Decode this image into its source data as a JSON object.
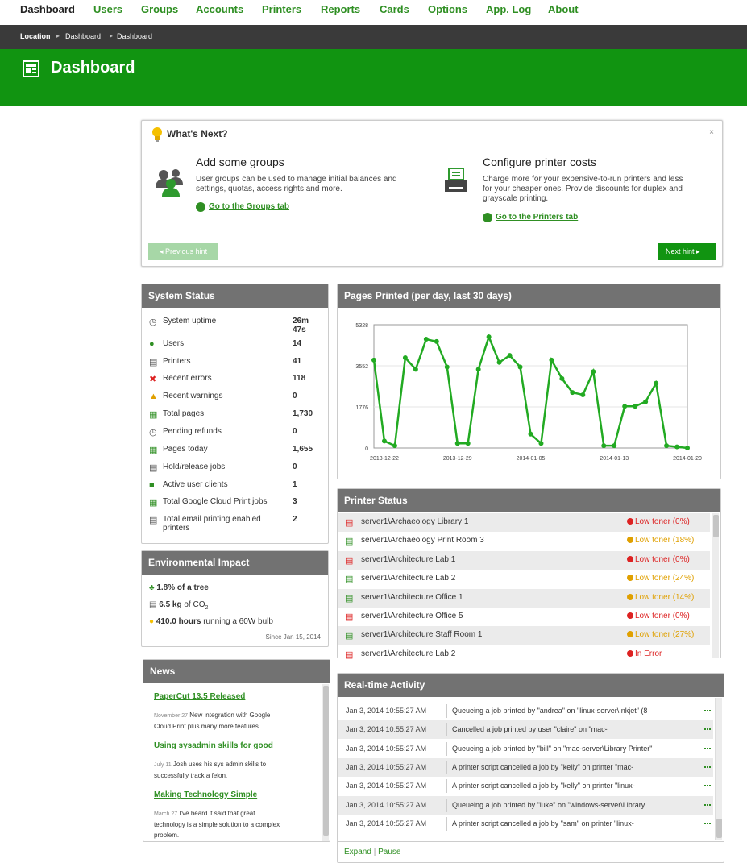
{
  "nav": {
    "items": [
      "Dashboard",
      "Users",
      "Groups",
      "Accounts",
      "Printers",
      "Reports",
      "Cards",
      "Options",
      "App. Log",
      "About"
    ]
  },
  "breadcrumb": {
    "location": "Location",
    "items": [
      "Dashboard",
      "Dashboard"
    ]
  },
  "header": {
    "title": "Dashboard"
  },
  "whats_next": {
    "title": "What's Next?",
    "close": "×",
    "left": {
      "heading": "Add some groups",
      "text1": "User groups can be used to manage initial balances and",
      "text2": "settings, quotas, access rights and more.",
      "link": "Go to the Groups tab"
    },
    "right": {
      "heading": "Configure printer costs",
      "text1": "Charge more for your expensive-to-run printers and less",
      "text2": "for your cheaper ones. Provide discounts for duplex and",
      "text3": "grayscale printing.",
      "link": "Go to the Printers tab"
    },
    "prev_label": "Previous hint",
    "next_label": "Next hint"
  },
  "system_status": {
    "title": "System Status",
    "rows": [
      {
        "label": "System uptime",
        "value": "26m",
        "value2": "47s",
        "icon": "clock-icon"
      },
      {
        "label": "Users",
        "value": "14",
        "icon": "users-icon"
      },
      {
        "label": "Printers",
        "value": "41",
        "icon": "printer-icon"
      },
      {
        "label": "Recent errors",
        "value": "118",
        "icon": "error-x-icon"
      },
      {
        "label": "Recent warnings",
        "value": "0",
        "icon": "warning-icon"
      },
      {
        "label": "Total pages",
        "value": "1,730",
        "icon": "pages-icon"
      },
      {
        "label": "Pending refunds",
        "value": "0",
        "icon": "clock-icon"
      },
      {
        "label": "Pages today",
        "value": "1,655",
        "icon": "pages-icon"
      },
      {
        "label": "Hold/release jobs",
        "value": "0",
        "icon": "printer-icon"
      },
      {
        "label": "Active user clients",
        "value": "1",
        "icon": "client-icon"
      },
      {
        "label": "Total Google Cloud Print jobs",
        "value": "3",
        "icon": "pages-icon"
      },
      {
        "label": "Total email printing enabled",
        "label2": "printers",
        "value": "2",
        "icon": "printer-icon"
      }
    ]
  },
  "environment": {
    "title": "Environmental Impact",
    "tree_value": "1.8% of a tree",
    "co2_value": "6.5 kg",
    "co2_rest": "of CO",
    "co2_sub": "2",
    "bulb_value": "410.0 hours",
    "bulb_rest": "running a 60W bulb",
    "since": "Since Jan 15, 2014"
  },
  "news": {
    "title": "News",
    "items": [
      {
        "title": "PaperCut 13.5 Released",
        "date": "November 27",
        "text1": "New integration with Google",
        "text2": "Cloud Print plus many more features."
      },
      {
        "title": "Using sysadmin skills for good",
        "date": "July 11",
        "text1": "Josh uses his sys admin skills to",
        "text2": "successfully track a felon."
      },
      {
        "title": "Making Technology Simple",
        "date": "March 27",
        "text1": "I've heard it said that great",
        "text2": "technology is a simple solution to a complex",
        "text3": "problem."
      }
    ]
  },
  "chart_data": {
    "type": "line",
    "title": "Pages Printed (per day, last 30 days)",
    "x": [
      "2013-12-21",
      "2013-12-22",
      "2013-12-23",
      "2013-12-24",
      "2013-12-25",
      "2013-12-26",
      "2013-12-27",
      "2013-12-28",
      "2013-12-29",
      "2013-12-30",
      "2013-12-31",
      "2014-01-01",
      "2014-01-02",
      "2014-01-03",
      "2014-01-04",
      "2014-01-05",
      "2014-01-06",
      "2014-01-07",
      "2014-01-08",
      "2014-01-09",
      "2014-01-10",
      "2014-01-11",
      "2014-01-12",
      "2014-01-13",
      "2014-01-14",
      "2014-01-15",
      "2014-01-16",
      "2014-01-17",
      "2014-01-18",
      "2014-01-19",
      "2014-01-20"
    ],
    "series": [
      {
        "values": [
          3800,
          300,
          100,
          3900,
          3400,
          4700,
          4600,
          3500,
          200,
          200,
          3400,
          4800,
          3700,
          4000,
          3500,
          600,
          200,
          3800,
          3000,
          2400,
          2300,
          3300,
          100,
          100,
          1800,
          1800,
          2000,
          2800,
          100,
          50,
          0
        ]
      }
    ],
    "y_ticks": [
      "0",
      "1776",
      "3552",
      "5328"
    ],
    "x_ticks": [
      "2013-12-22",
      "2013-12-29",
      "2014-01-05",
      "2014-01-13",
      "2014-01-20"
    ],
    "ylim": [
      0,
      5328
    ],
    "color": "#22aa22",
    "grid": true
  },
  "printer_status": {
    "title": "Printer Status",
    "rows": [
      {
        "name": "server1\\Archaeology Library 1",
        "status": "Low toner (0%)",
        "level": "error"
      },
      {
        "name": "server1\\Archaeology Print Room 3",
        "status": "Low toner (18%)",
        "level": "warn"
      },
      {
        "name": "server1\\Architecture Lab 1",
        "status": "Low toner (0%)",
        "level": "error"
      },
      {
        "name": "server1\\Architecture Lab 2",
        "status": "Low toner (24%)",
        "level": "warn"
      },
      {
        "name": "server1\\Architecture Office 1",
        "status": "Low toner (14%)",
        "level": "warn"
      },
      {
        "name": "server1\\Architecture Office 5",
        "status": "Low toner (0%)",
        "level": "error"
      },
      {
        "name": "server1\\Architecture Staff Room 1",
        "status": "Low toner (27%)",
        "level": "warn"
      },
      {
        "name": "server1\\Architecture Lab 2",
        "status": "In Error",
        "level": "error"
      }
    ]
  },
  "activity": {
    "title": "Real-time Activity",
    "rows": [
      {
        "time": "Jan 3, 2014 10:55:27 AM",
        "msg": "Queueing a job printed by \"andrea\" on \"linux-server\\Inkjet\" (8"
      },
      {
        "time": "Jan 3, 2014 10:55:27 AM",
        "msg": "Cancelled a job printed by user \"claire\" on \"mac-"
      },
      {
        "time": "Jan 3, 2014 10:55:27 AM",
        "msg": "Queueing a job printed by \"bill\" on \"mac-server\\Library Printer\""
      },
      {
        "time": "Jan 3, 2014 10:55:27 AM",
        "msg": "A printer script cancelled a job by \"kelly\" on printer \"mac-"
      },
      {
        "time": "Jan 3, 2014 10:55:27 AM",
        "msg": "A printer script cancelled a job by \"kelly\" on printer \"linux-"
      },
      {
        "time": "Jan 3, 2014 10:55:27 AM",
        "msg": "Queueing a job printed by \"luke\" on \"windows-server\\Library"
      },
      {
        "time": "Jan 3, 2014 10:55:27 AM",
        "msg": "A printer script cancelled a job by \"sam\" on printer \"linux-"
      }
    ],
    "expand": "Expand",
    "sep": "|",
    "pause": "Pause"
  },
  "colors": {
    "brand_green": "#119411",
    "link_green": "#2f8f23",
    "error_red": "#dd2222",
    "warn_orange": "#e0a000"
  }
}
